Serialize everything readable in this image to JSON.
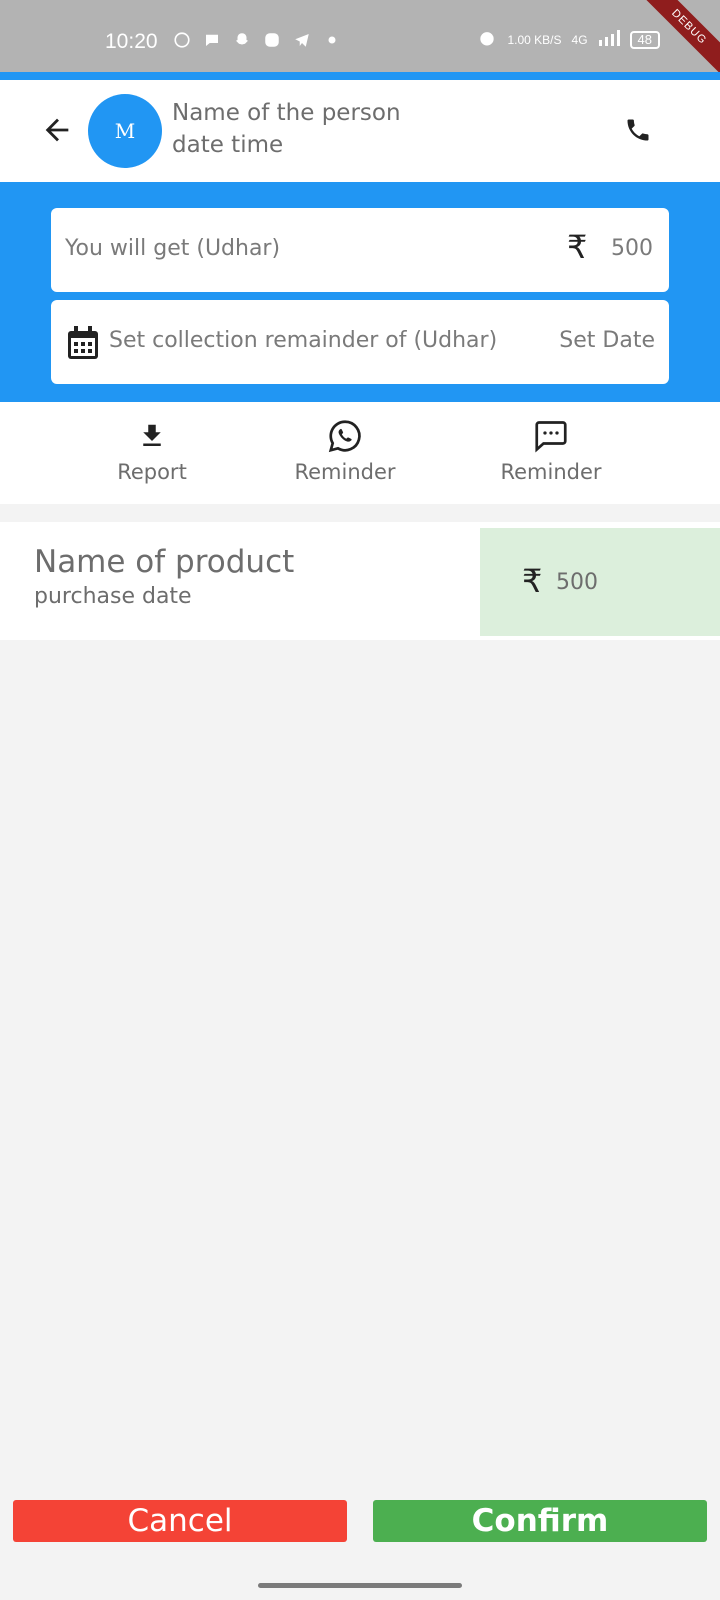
{
  "status_bar": {
    "time": "10:20",
    "network_speed": "1.00 KB/S",
    "network_type": "4G",
    "battery": "48",
    "debug_label": "DEBUG"
  },
  "header": {
    "avatar_letter": "M",
    "person_name": "Name of the person",
    "date_time": "date time"
  },
  "amount_field": {
    "label": "You will get (Udhar)",
    "currency_symbol": "₹",
    "value": "500"
  },
  "reminder_field": {
    "label": "Set collection remainder of (Udhar)",
    "action": "Set Date"
  },
  "actions": {
    "report": "Report",
    "whatsapp_reminder": "Reminder",
    "sms_reminder": "Reminder"
  },
  "product": {
    "name": "Name of product",
    "purchase_date": "purchase date",
    "currency_symbol": "₹",
    "amount": "500"
  },
  "buttons": {
    "cancel": "Cancel",
    "confirm": "Confirm"
  },
  "colors": {
    "primary": "#2196f3",
    "cancel": "#f44336",
    "confirm": "#4caf50",
    "amount_highlight": "#dcefdc"
  }
}
